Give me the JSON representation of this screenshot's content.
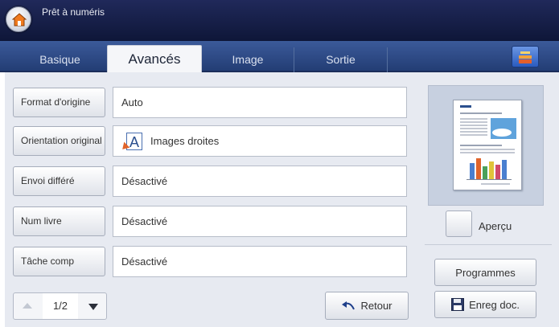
{
  "titlebar": {
    "title": "Prêt à numéris"
  },
  "tabs": [
    {
      "label": "Basique"
    },
    {
      "label": "Avancés"
    },
    {
      "label": "Image"
    },
    {
      "label": "Sortie"
    }
  ],
  "active_tab_index": 1,
  "rows": [
    {
      "button": "Format d'origine",
      "value": "Auto"
    },
    {
      "button": "Orientation original",
      "value": "Images droites",
      "value_icon": "portrait-orientation-icon"
    },
    {
      "button": "Envoi différé",
      "value": "Désactivé"
    },
    {
      "button": "Num livre",
      "value": "Désactivé"
    },
    {
      "button": "Tâche comp",
      "value": "Désactivé"
    }
  ],
  "pager": {
    "label": "1/2"
  },
  "retour": {
    "label": "Retour"
  },
  "preview": {
    "checkbox_label": "Aperçu"
  },
  "side_buttons": {
    "programmes": "Programmes",
    "save": "Enreg doc."
  },
  "colors": {
    "titlebar": "#151d44",
    "tabbar": "#2e4a86",
    "panel": "#e7eaf1",
    "accent_orange": "#e0642b"
  }
}
